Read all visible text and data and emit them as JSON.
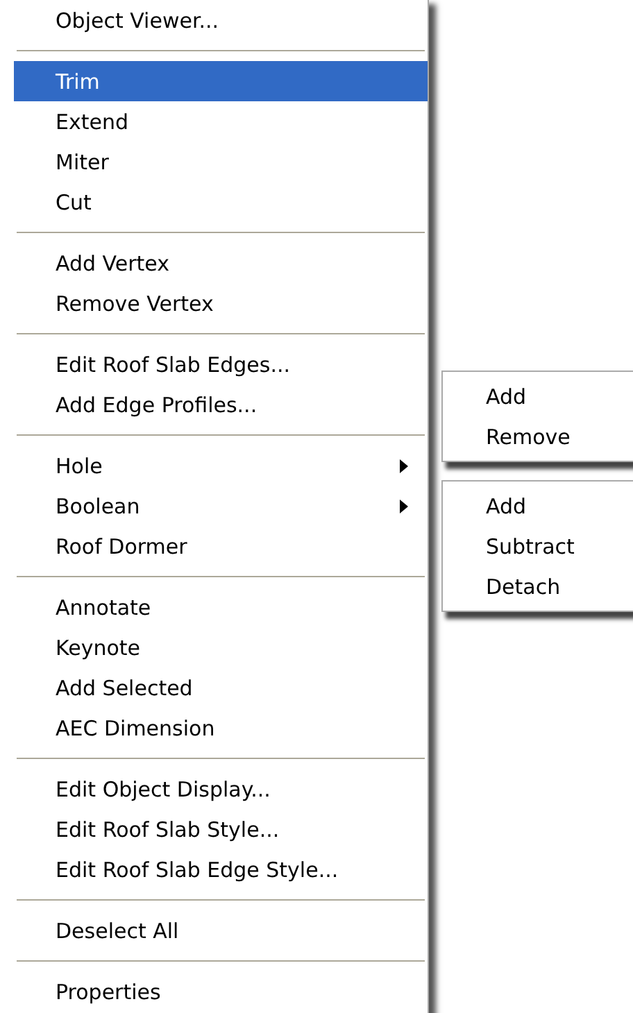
{
  "menu": {
    "groups": [
      {
        "items": [
          {
            "label": "Object Viewer...",
            "selected": false,
            "submenu": false
          }
        ]
      },
      {
        "items": [
          {
            "label": "Trim",
            "selected": true,
            "submenu": false
          },
          {
            "label": "Extend",
            "selected": false,
            "submenu": false
          },
          {
            "label": "Miter",
            "selected": false,
            "submenu": false
          },
          {
            "label": "Cut",
            "selected": false,
            "submenu": false
          }
        ]
      },
      {
        "items": [
          {
            "label": "Add Vertex",
            "selected": false,
            "submenu": false
          },
          {
            "label": "Remove Vertex",
            "selected": false,
            "submenu": false
          }
        ]
      },
      {
        "items": [
          {
            "label": "Edit Roof Slab Edges...",
            "selected": false,
            "submenu": false
          },
          {
            "label": "Add Edge Profiles...",
            "selected": false,
            "submenu": false
          }
        ]
      },
      {
        "items": [
          {
            "label": "Hole",
            "selected": false,
            "submenu": true
          },
          {
            "label": "Boolean",
            "selected": false,
            "submenu": true
          },
          {
            "label": "Roof Dormer",
            "selected": false,
            "submenu": false
          }
        ]
      },
      {
        "items": [
          {
            "label": "Annotate",
            "selected": false,
            "submenu": false
          },
          {
            "label": "Keynote",
            "selected": false,
            "submenu": false
          },
          {
            "label": "Add Selected",
            "selected": false,
            "submenu": false
          },
          {
            "label": "AEC Dimension",
            "selected": false,
            "submenu": false
          }
        ]
      },
      {
        "items": [
          {
            "label": "Edit Object Display...",
            "selected": false,
            "submenu": false
          },
          {
            "label": "Edit Roof Slab Style...",
            "selected": false,
            "submenu": false
          },
          {
            "label": "Edit Roof Slab Edge Style...",
            "selected": false,
            "submenu": false
          }
        ]
      },
      {
        "items": [
          {
            "label": "Deselect All",
            "selected": false,
            "submenu": false
          }
        ]
      },
      {
        "items": [
          {
            "label": "Properties",
            "selected": false,
            "submenu": false
          }
        ]
      }
    ]
  },
  "submenus": [
    {
      "items": [
        {
          "label": "Add",
          "selected": false
        },
        {
          "label": "Remove",
          "selected": false
        }
      ]
    },
    {
      "items": [
        {
          "label": "Add",
          "selected": false
        },
        {
          "label": "Subtract",
          "selected": false
        },
        {
          "label": "Detach",
          "selected": false
        }
      ]
    }
  ]
}
